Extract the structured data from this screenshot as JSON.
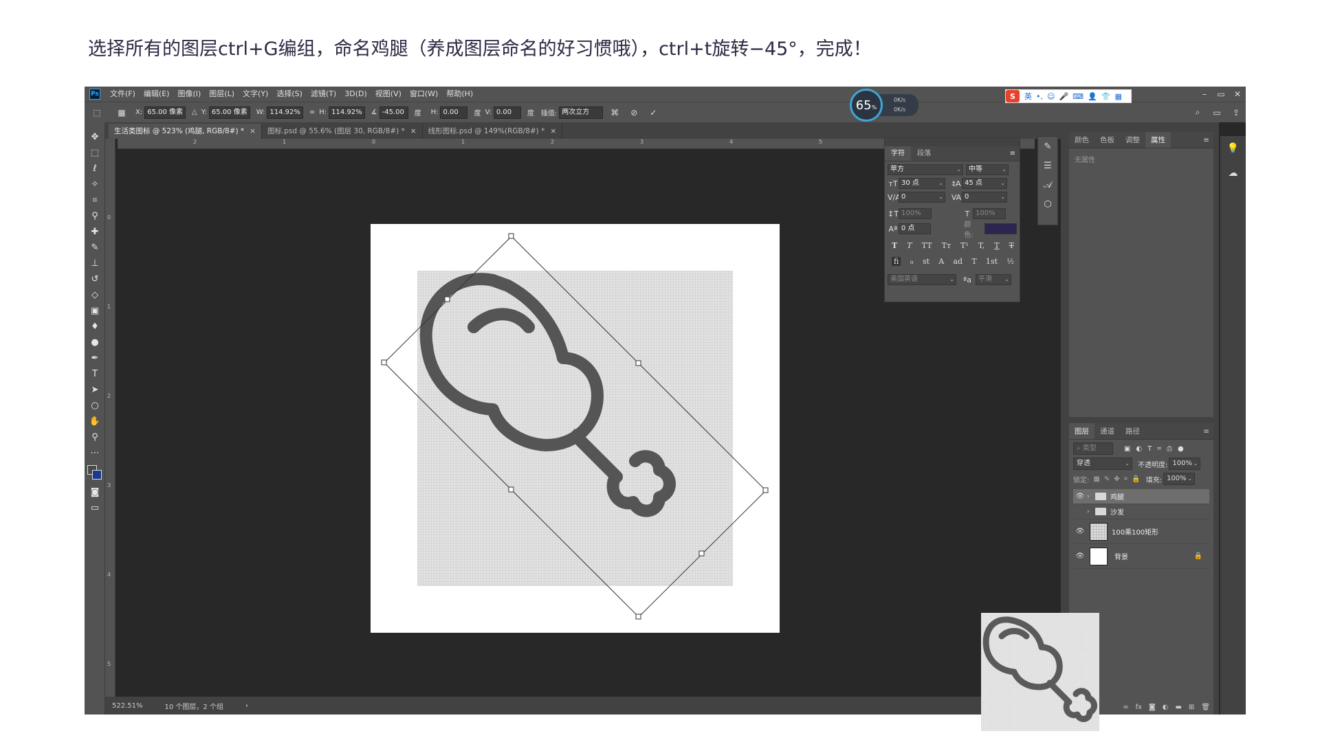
{
  "instruction": "选择所有的图层ctrl+G编组，命名鸡腿（养成图层命名的好习惯哦），ctrl+t旋转−45°，完成！",
  "menubar": {
    "logo": "Ps",
    "items": [
      "文件(F)",
      "编辑(E)",
      "图像(I)",
      "图层(L)",
      "文字(Y)",
      "选择(S)",
      "滤镜(T)",
      "3D(D)",
      "视图(V)",
      "窗口(W)",
      "帮助(H)"
    ],
    "window_controls": [
      "–",
      "▭",
      "✕"
    ]
  },
  "netmeter": {
    "percent": "65",
    "unit": "%",
    "up": "0K/s",
    "down": "0K/s"
  },
  "ime": {
    "logo": "S",
    "lang": "英",
    "icons": [
      "•,",
      "☺",
      "🎤",
      "⌨",
      "👤",
      "👕",
      "▦"
    ]
  },
  "options": {
    "x_label": "X:",
    "x_value": "65.00 像素",
    "y_label": "Y:",
    "y_value": "65.00 像素",
    "w_label": "W:",
    "w_value": "114.92%",
    "h_label": "H:",
    "h_value": "114.92%",
    "angle_value": "-45.00",
    "deg": "度",
    "hskew_label": "H:",
    "hskew_value": "0.00",
    "vskew_label": "V:",
    "vskew_value": "0.00",
    "interp_label": "插值:",
    "interp_value": "两次立方"
  },
  "tabs": [
    {
      "label": "生活类图标 @ 523% (鸡腿, RGB/8#) *",
      "close": "×"
    },
    {
      "label": "图标.psd @ 55.6% (图层 30, RGB/8#) *",
      "close": "×"
    },
    {
      "label": "线形图标.psd @ 149%(RGB/8#) *",
      "close": "×"
    }
  ],
  "ruler_h": [
    "2",
    "1",
    "0",
    "1",
    "2",
    "3",
    "4",
    "5"
  ],
  "ruler_v": [
    "0",
    "1",
    "2",
    "3",
    "4",
    "5"
  ],
  "status": {
    "zoom": "522.51%",
    "info": "10 个图层，2 个组",
    "arrow": "›"
  },
  "character_panel": {
    "tabs": [
      "字符",
      "段落"
    ],
    "font": "苹方",
    "weight": "中等",
    "size": "30 点",
    "leading": "45 点",
    "kerning": "0",
    "tracking": "0",
    "vscale": "100%",
    "hscale": "100%",
    "baseline": "0 点",
    "color_label": "颜色:",
    "color_value": "#2c2550",
    "styles": [
      "T",
      "T",
      "TT",
      "Tт",
      "T¹",
      "T,",
      "T",
      "T"
    ],
    "opentype": [
      "fi",
      "ℴ",
      "st",
      "A",
      "ad",
      "T",
      "1st",
      "½"
    ],
    "language": "美国英语",
    "aa_label": "ªa",
    "aa_value": "平滑"
  },
  "props_panel": {
    "tabs": [
      "颜色",
      "色板",
      "调整",
      "属性"
    ],
    "empty": "无属性"
  },
  "layers_panel": {
    "tabs": [
      "图层",
      "通道",
      "路径"
    ],
    "filter_placeholder": "类型",
    "blend": "穿透",
    "opacity_label": "不透明度:",
    "opacity_value": "100%",
    "lock_label": "锁定:",
    "fill_label": "填充:",
    "fill_value": "100%",
    "layers": [
      {
        "name": "鸡腿",
        "type": "group",
        "visible": true,
        "selected": true
      },
      {
        "name": "沙发",
        "type": "group",
        "visible": false,
        "selected": false
      },
      {
        "name": "100乘100矩形",
        "type": "layer",
        "visible": true,
        "selected": false
      },
      {
        "name": "背景",
        "type": "background",
        "visible": true,
        "selected": false
      }
    ],
    "footer_icons": [
      "link-icon",
      "fx",
      "mask-icon",
      "adjust-icon",
      "folder-icon",
      "new-layer-icon",
      "trash-icon"
    ]
  },
  "colors": {
    "ui_dark": "#282828",
    "ui_panel": "#535353",
    "accent_text": "#2a2a44",
    "icon_stroke": "#555555"
  }
}
